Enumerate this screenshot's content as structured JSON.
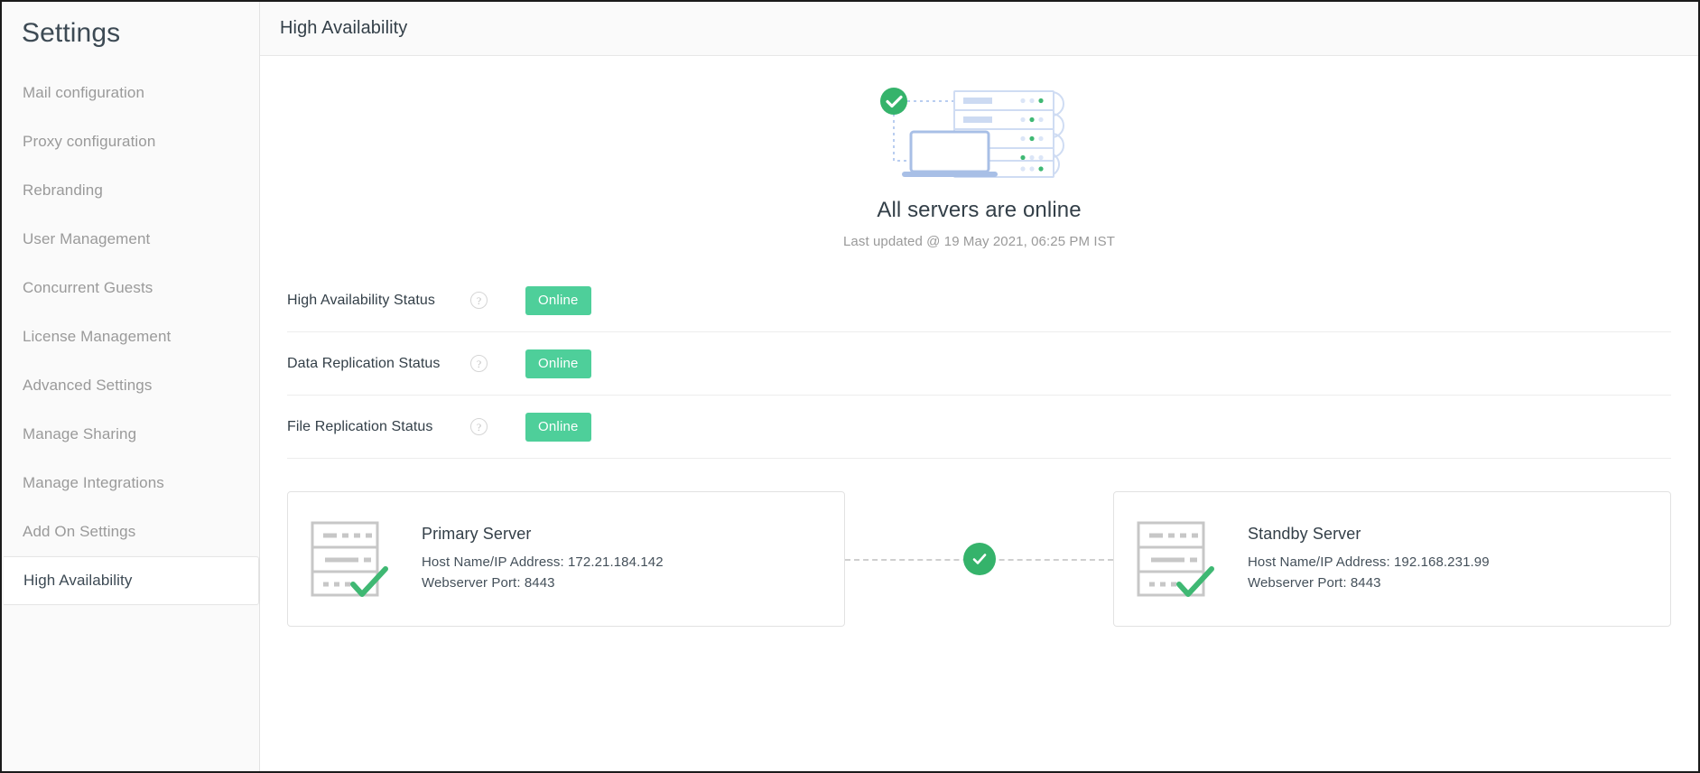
{
  "sidebar": {
    "title": "Settings",
    "items": [
      {
        "label": "Mail configuration",
        "active": false
      },
      {
        "label": "Proxy configuration",
        "active": false
      },
      {
        "label": "Rebranding",
        "active": false
      },
      {
        "label": "User Management",
        "active": false
      },
      {
        "label": "Concurrent Guests",
        "active": false
      },
      {
        "label": "License Management",
        "active": false
      },
      {
        "label": "Advanced Settings",
        "active": false
      },
      {
        "label": "Manage Sharing",
        "active": false
      },
      {
        "label": "Manage Integrations",
        "active": false
      },
      {
        "label": "Add On Settings",
        "active": false
      },
      {
        "label": "High Availability",
        "active": true
      }
    ]
  },
  "header": {
    "title": "High Availability"
  },
  "hero": {
    "illustration_name": "servers-online-illustration",
    "status_text": "All servers are online",
    "last_updated": "Last updated @ 19 May 2021, 06:25 PM IST"
  },
  "status_rows": [
    {
      "label": "High Availability Status",
      "help": "?",
      "badge": "Online"
    },
    {
      "label": "Data Replication Status",
      "help": "?",
      "badge": "Online"
    },
    {
      "label": "File Replication Status",
      "help": "?",
      "badge": "Online"
    }
  ],
  "servers": {
    "primary": {
      "title": "Primary Server",
      "host": "Host Name/IP Address: 172.21.184.142",
      "port": "Webserver Port: 8443"
    },
    "standby": {
      "title": "Standby Server",
      "host": "Host Name/IP Address: 192.168.231.99",
      "port": "Webserver Port: 8443"
    },
    "link_status_icon": "check-circle-icon"
  },
  "colors": {
    "badge_green": "#4ecf9a",
    "check_green": "#35b36b",
    "illustration_blue": "#a8bfe6",
    "text_dark": "#333f48",
    "text_muted": "#9a9a9a"
  }
}
